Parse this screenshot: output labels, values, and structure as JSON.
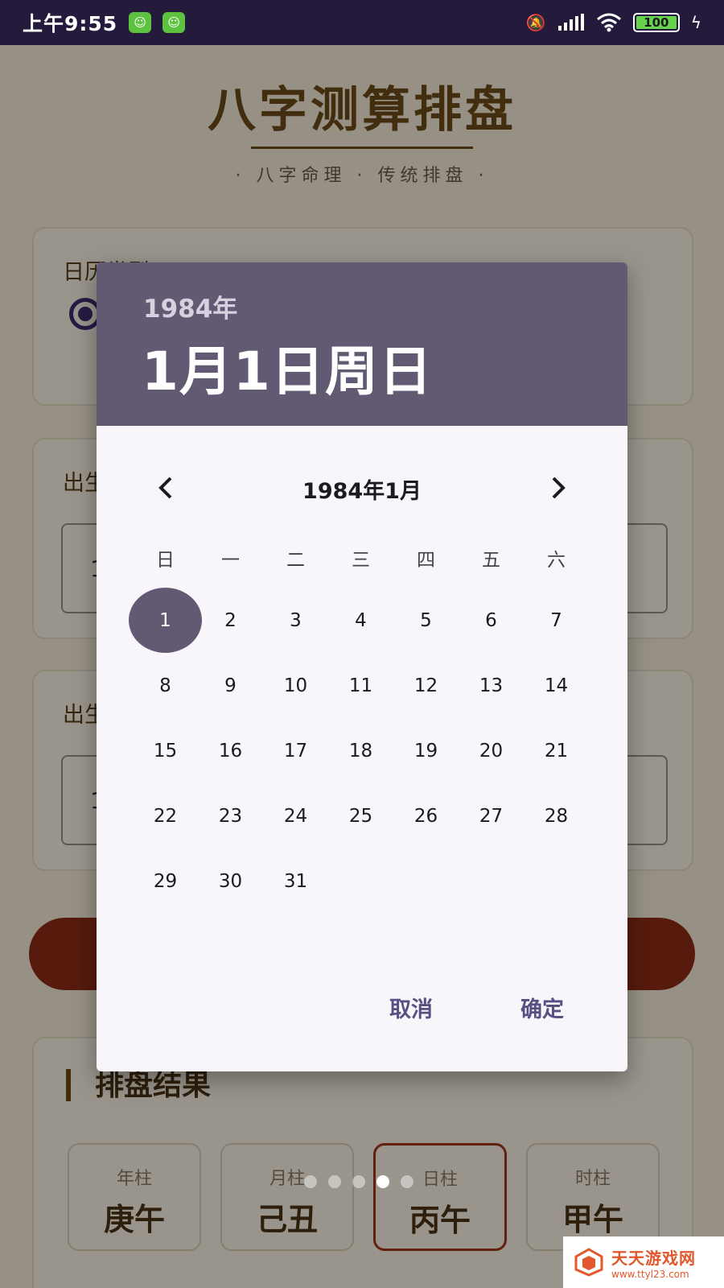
{
  "status_bar": {
    "time": "上午9:55",
    "battery": "100",
    "battery_level": 1.0,
    "icons": [
      "app-badge-icon",
      "mute-icon",
      "signal-icon",
      "wifi-icon",
      "battery-icon",
      "charging-icon"
    ]
  },
  "page": {
    "title": "八字测算排盘",
    "subtitle": "· 八字命理 · 传统排盘 ·",
    "calendar_type_label": "日历类型",
    "birth_date_label": "出生日期",
    "birth_time_label": "出生时间",
    "field_date_value": "1",
    "field_time_value": "1",
    "result_title": "排盘结果",
    "pillars": [
      {
        "label": "年柱",
        "value": "庚午"
      },
      {
        "label": "月柱",
        "value": "己丑"
      },
      {
        "label": "日柱",
        "value": "丙午"
      },
      {
        "label": "时柱",
        "value": "甲午"
      }
    ],
    "active_pillar_index": 2
  },
  "date_picker": {
    "header_year": "1984年",
    "header_date": "1月1日周日",
    "month_label": "1984年1月",
    "prev_icon": "chevron-left-icon",
    "next_icon": "chevron-right-icon",
    "weekdays": [
      "日",
      "一",
      "二",
      "三",
      "四",
      "五",
      "六"
    ],
    "first_weekday_offset": 0,
    "days_in_month": 31,
    "selected_day": 1,
    "cancel_label": "取消",
    "ok_label": "确定",
    "accent_color": "#625a73"
  },
  "page_indicator": {
    "count": 5,
    "active_index": 3
  },
  "watermark": {
    "name": "天天游戏网",
    "url": "www.ttyl23.com"
  }
}
